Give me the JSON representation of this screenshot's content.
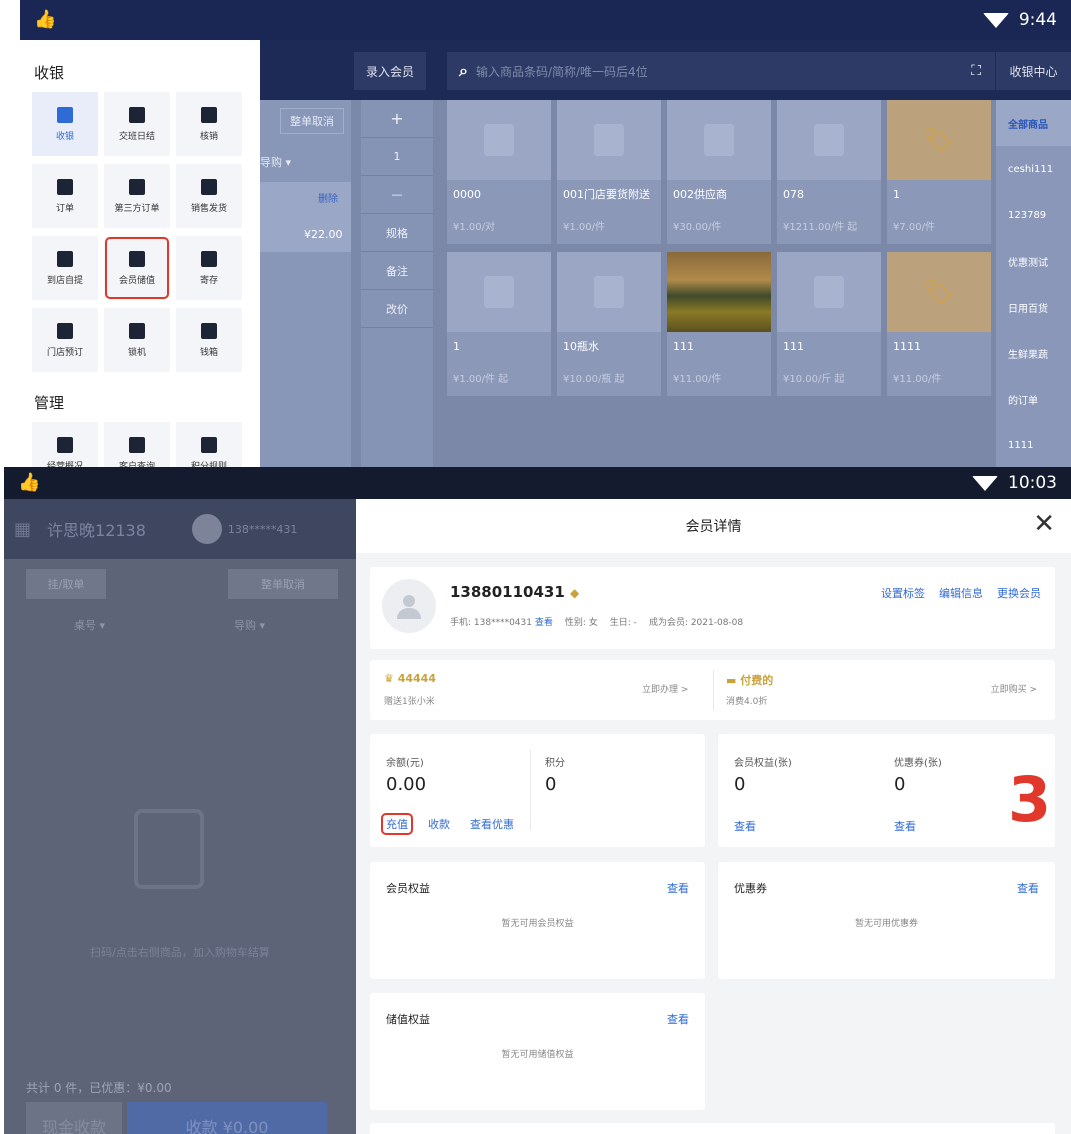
{
  "screen1": {
    "status_time": "9:44",
    "enter_member": "录入会员",
    "search_placeholder": "输入商品条码/简称/唯一码后4位",
    "cashier_center": "收银中心",
    "cart": {
      "clear": "整单取消",
      "guide": "导购 ▾",
      "delete": "删除",
      "price": "¥22.00"
    },
    "ops": [
      "+",
      "1",
      "—",
      "规格",
      "备注",
      "改价"
    ],
    "menu": {
      "section1": "收银",
      "items": [
        {
          "label": "收银",
          "icon": "cashier-icon"
        },
        {
          "label": "交班日结",
          "icon": "shift-icon"
        },
        {
          "label": "核销",
          "icon": "scan-icon"
        },
        {
          "label": "订单",
          "icon": "order-icon"
        },
        {
          "label": "第三方订单",
          "icon": "thirdparty-order-icon"
        },
        {
          "label": "销售发货",
          "icon": "ship-icon"
        },
        {
          "label": "到店自提",
          "icon": "pickup-icon"
        },
        {
          "label": "会员储值",
          "icon": "card-icon"
        },
        {
          "label": "寄存",
          "icon": "luggage-icon"
        },
        {
          "label": "门店预订",
          "icon": "calendar-icon"
        },
        {
          "label": "锁机",
          "icon": "lock-icon"
        },
        {
          "label": "钱箱",
          "icon": "cashbox-icon"
        }
      ],
      "section2": "管理",
      "items2": [
        {
          "label": "经营概况",
          "icon": "pie-icon"
        },
        {
          "label": "客户查询",
          "icon": "user-icon"
        },
        {
          "label": "积分规则",
          "icon": "coins-icon"
        }
      ]
    },
    "products": [
      {
        "name": "0000",
        "price": "¥1.00/对",
        "img": "bag"
      },
      {
        "name": "001门店要货附送",
        "price": "¥1.00/件",
        "img": "bag"
      },
      {
        "name": "002供应商",
        "price": "¥30.00/件",
        "img": "bag"
      },
      {
        "name": "078",
        "price": "¥1211.00/件 起",
        "img": "bag"
      },
      {
        "name": "1",
        "price": "¥7.00/件",
        "img": "tags"
      },
      {
        "name": "1",
        "price": "¥1.00/件 起",
        "img": "bag"
      },
      {
        "name": "10瓶水",
        "price": "¥10.00/瓶 起",
        "img": "bag"
      },
      {
        "name": "111",
        "price": "¥11.00/件",
        "img": "sunflower"
      },
      {
        "name": "111",
        "price": "¥10.00/斤 起",
        "img": "bag"
      },
      {
        "name": "1111",
        "price": "¥11.00/件",
        "img": "tags"
      }
    ],
    "categories": [
      "全部商品",
      "ceshi111",
      "123789",
      "优惠测试",
      "日用百货",
      "生鲜果蔬",
      "的订单",
      "1111"
    ]
  },
  "screen2": {
    "status_time": "10:03",
    "store_name": "许思晚12138",
    "phone_masked": "138*****431",
    "hang_order": "挂/取单",
    "clear_order": "整单取消",
    "table_no": "桌号 ▾",
    "guide": "导购 ▾",
    "empty_hint": "扫码/点击右侧商品，加入购物车结算",
    "total": "共计 0 件，已优惠：¥0.00",
    "cash_pay": "现金收款",
    "pay": "收款 ¥0.00",
    "modal": {
      "title": "会员详情",
      "phone": "13880110431",
      "details": "手机: 138****0431",
      "view": "查看",
      "gender": "性别: 女",
      "birthday": "生日: -",
      "member_since": "成为会员: 2021-08-08",
      "actions": [
        "设置标签",
        "编辑信息",
        "更换会员"
      ],
      "level_name": "44444",
      "level_sub": "赠送1张小米",
      "level_action": "立即办理 >",
      "paid_name": "付费的",
      "paid_sub": "消费4.0折",
      "paid_action": "立即购买 >",
      "balance_label": "余额(元)",
      "balance_value": "0.00",
      "points_label": "积分",
      "points_value": "0",
      "recharge": "充值",
      "refund": "收款",
      "view_coupon": "查看优惠",
      "rights_label": "会员权益(张)",
      "rights_value": "0",
      "rights_view": "查看",
      "coupons_label": "优惠券(张)",
      "coupons_value": "0",
      "coupons_view": "查看",
      "rights_title": "会员权益",
      "rights_empty": "暂无可用会员权益",
      "coupon_title": "优惠券",
      "coupon_empty": "暂无可用优惠券",
      "stored_title": "储值权益",
      "stored_empty": "暂无可用储值权益",
      "annotation": "3"
    }
  },
  "colors": {
    "accent": "#2f6bd6",
    "highlight": "#e0392b",
    "gold": "#c9a23a",
    "navy": "#1a2754"
  }
}
